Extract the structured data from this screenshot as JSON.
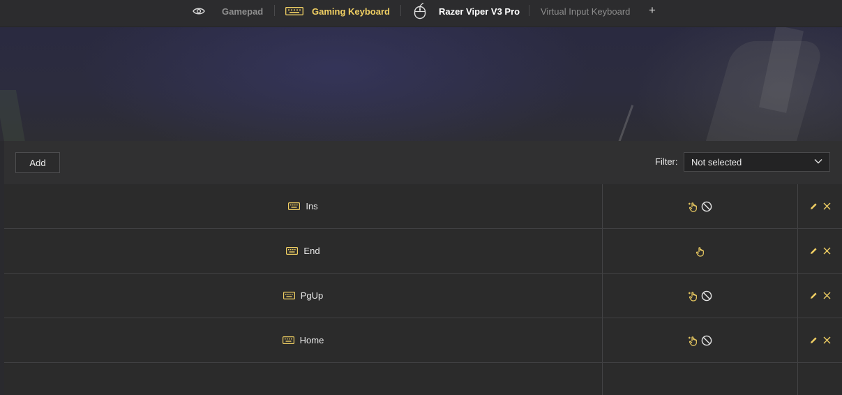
{
  "tabs": [
    {
      "label": "Gamepad",
      "icon": "eye-icon",
      "color": "#8e8e8e"
    },
    {
      "label": "Gaming Keyboard",
      "icon": "keyboard-icon",
      "color": "#f0cf63"
    },
    {
      "label": "Razer Viper V3 Pro",
      "icon": "mouse-icon",
      "color": "#ffffff"
    },
    {
      "label": "Virtual Input Keyboard",
      "icon": null,
      "color": "#8c8c8c"
    }
  ],
  "add_tab_label": "+",
  "toolbar": {
    "add_label": "Add",
    "filter_label": "Filter:",
    "filter_value": "Not selected"
  },
  "rows": [
    {
      "key": "Ins",
      "modes": [
        "hold",
        "blocked"
      ]
    },
    {
      "key": "End",
      "modes": [
        "hold"
      ]
    },
    {
      "key": "PgUp",
      "modes": [
        "hold",
        "blocked"
      ]
    },
    {
      "key": "Home",
      "modes": [
        "hold",
        "blocked"
      ]
    }
  ],
  "colors": {
    "accent": "#f0cf63",
    "background": "#2b2b2b",
    "toolbar": "#303031"
  }
}
